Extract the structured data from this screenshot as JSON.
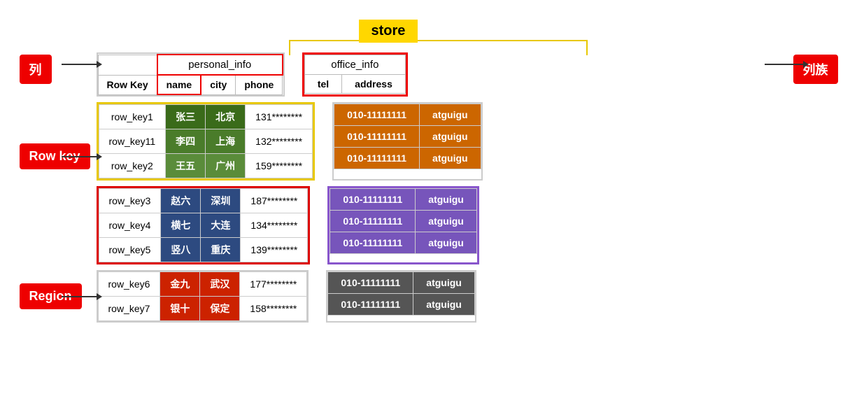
{
  "store_label": "store",
  "col_label": "列",
  "col_family_label": "列族",
  "row_key_label": "Row key",
  "region_label": "Region",
  "personal_info_label": "personal_info",
  "office_info_label": "office_info",
  "headers": {
    "row_key": "Row Key",
    "name": "name",
    "city": "city",
    "phone": "phone",
    "tel": "tel",
    "address": "address"
  },
  "rows": [
    {
      "id": "row_key1",
      "name": "张三",
      "city": "北京",
      "phone": "131********",
      "tel": "010-11111111",
      "address": "atguigu",
      "group": "yellow"
    },
    {
      "id": "row_key11",
      "name": "李四",
      "city": "上海",
      "phone": "132********",
      "tel": "010-11111111",
      "address": "atguigu",
      "group": "yellow"
    },
    {
      "id": "row_key2",
      "name": "王五",
      "city": "广州",
      "phone": "159********",
      "tel": "010-11111111",
      "address": "atguigu",
      "group": "yellow"
    },
    {
      "id": "row_key3",
      "name": "赵六",
      "city": "深圳",
      "phone": "187********",
      "tel": "010-11111111",
      "address": "atguigu",
      "group": "blue-purple"
    },
    {
      "id": "row_key4",
      "name": "横七",
      "city": "大连",
      "phone": "134********",
      "tel": "010-11111111",
      "address": "atguigu",
      "group": "blue-purple"
    },
    {
      "id": "row_key5",
      "name": "竖八",
      "city": "重庆",
      "phone": "139********",
      "tel": "010-11111111",
      "address": "atguigu",
      "group": "blue-purple"
    },
    {
      "id": "row_key6",
      "name": "金九",
      "city": "武汉",
      "phone": "177********",
      "tel": "010-11111111",
      "address": "atguigu",
      "group": "red-gray"
    },
    {
      "id": "row_key7",
      "name": "银十",
      "city": "保定",
      "phone": "158********",
      "tel": "010-11111111",
      "address": "atguigu",
      "group": "red-gray"
    }
  ],
  "colors": {
    "yellow_border": "#e8c800",
    "red_border": "#dd0000",
    "purple_border": "#8855cc",
    "store_bg": "#FFD700",
    "green_name": "#3d6b20",
    "green_city": "#3d6b20",
    "blue_name": "#2d4a80",
    "blue_city": "#2d4a80",
    "orange_tel": "#cc6600",
    "purple_tel": "#7755bb",
    "red_name": "#cc2200",
    "gray_tel": "#555555"
  }
}
